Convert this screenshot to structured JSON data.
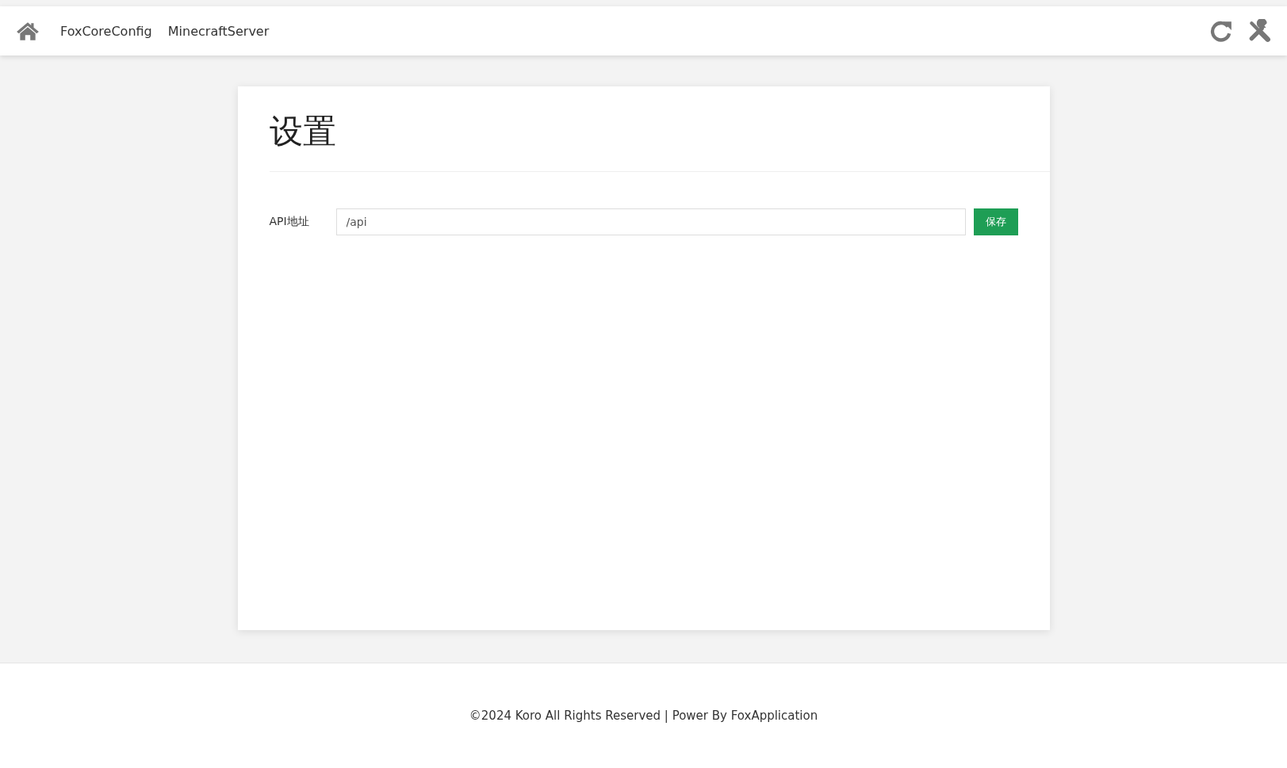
{
  "navbar": {
    "links": [
      {
        "label": "FoxCoreConfig"
      },
      {
        "label": "MinecraftServer"
      }
    ]
  },
  "page": {
    "title": "设置",
    "form": {
      "label": "API地址",
      "value": "/api",
      "button": "保存"
    }
  },
  "footer": {
    "text": "©2024 Koro All Rights Reserved | Power By FoxApplication"
  }
}
